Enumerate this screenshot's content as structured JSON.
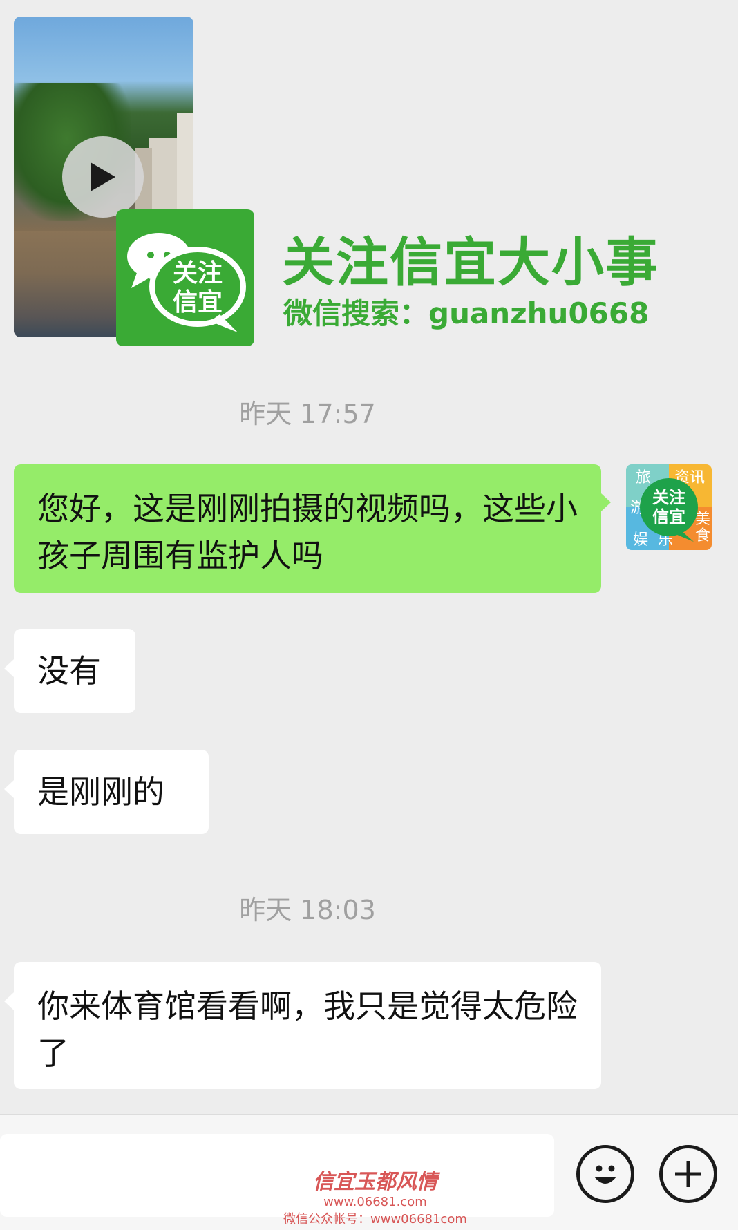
{
  "video_message": {
    "play_icon": "play-icon"
  },
  "banner": {
    "logo_text": "关注信宜",
    "title": "关注信宜大小事",
    "subtitle": "微信搜索：guanzhu0668",
    "color": "#3aaa35"
  },
  "messages": [
    {
      "type": "timestamp",
      "text": "昨天 17:57"
    },
    {
      "type": "outgoing",
      "text": "您好，这是刚刚拍摄的视频吗，这些小孩子周围有监护人吗"
    },
    {
      "type": "incoming",
      "text": "没有"
    },
    {
      "type": "incoming",
      "text": "是刚刚的"
    },
    {
      "type": "timestamp",
      "text": "昨天 18:03"
    },
    {
      "type": "incoming",
      "text": "你来体育馆看看啊，我只是觉得太危险了"
    }
  ],
  "avatar": {
    "center_text": "关注信宜",
    "corner_labels": [
      "旅",
      "资讯",
      "游",
      "美",
      "娱",
      "乐",
      "食"
    ]
  },
  "input_bar": {
    "emoji_icon": "smiley-icon",
    "plus_icon": "plus-icon"
  },
  "watermark": {
    "title": "信宜玉都风情",
    "url": "www.06681.com",
    "account": "微信公众帐号：www06681com"
  },
  "colors": {
    "outgoing_bubble": "#95ec69",
    "incoming_bubble": "#ffffff",
    "background": "#ededed"
  }
}
